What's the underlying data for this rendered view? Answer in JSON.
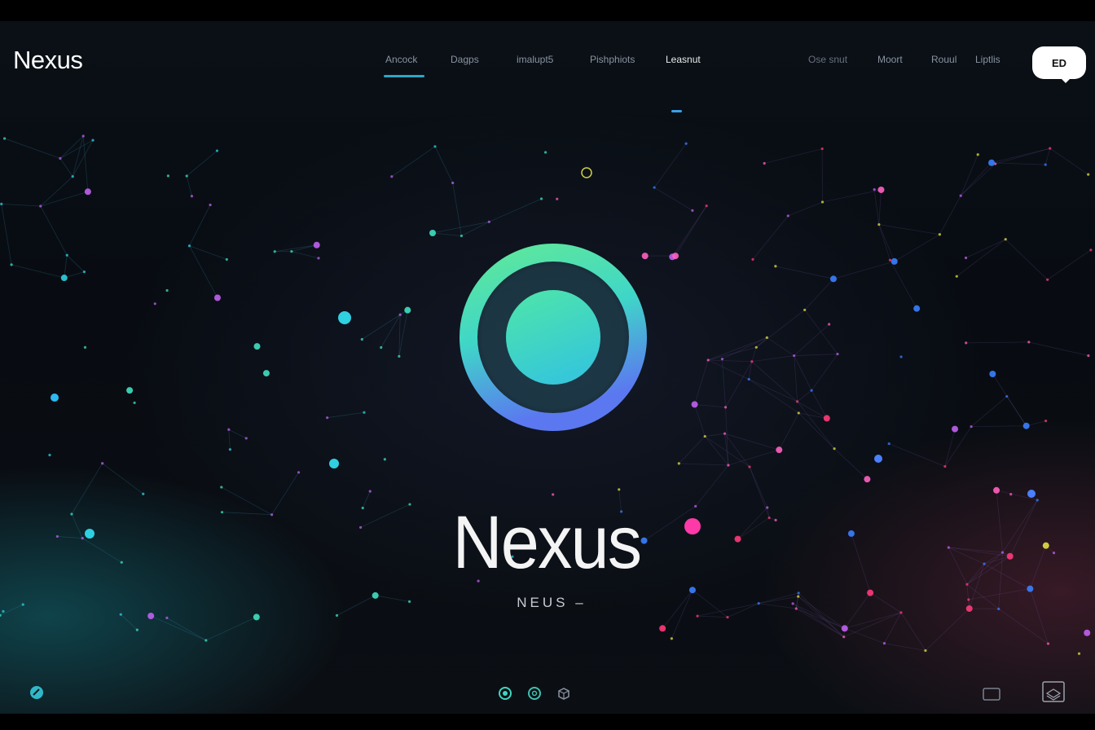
{
  "brand": {
    "name": "Nexus"
  },
  "nav": {
    "items": [
      {
        "label": "Ancock",
        "state": "default"
      },
      {
        "label": "Dagps",
        "state": "default"
      },
      {
        "label": "imalupt5",
        "state": "default"
      },
      {
        "label": "Pishphiots",
        "state": "default"
      },
      {
        "label": "Leasnut",
        "state": "active"
      },
      {
        "label": "Ose snut",
        "state": "dim"
      },
      {
        "label": "Moort",
        "state": "default"
      },
      {
        "label": "Rouul",
        "state": "default"
      },
      {
        "label": "Liptlis",
        "state": "default"
      }
    ]
  },
  "chat_button": {
    "label": "ED"
  },
  "hero": {
    "title": "Nexus",
    "subtitle": "NEUS –"
  },
  "bottom_icons": [
    "node-icon",
    "target-icon",
    "cube-icon",
    "square-icon",
    "layers-icon"
  ],
  "colors": {
    "background": "#0a0f15",
    "accent_teal": "#3fe0c0",
    "accent_blue": "#5b7ff0",
    "accent_green": "#4fe89a",
    "accent_pink": "#ff3aa8",
    "text_primary": "#ffffff",
    "nav_text": "#8a93a0"
  }
}
